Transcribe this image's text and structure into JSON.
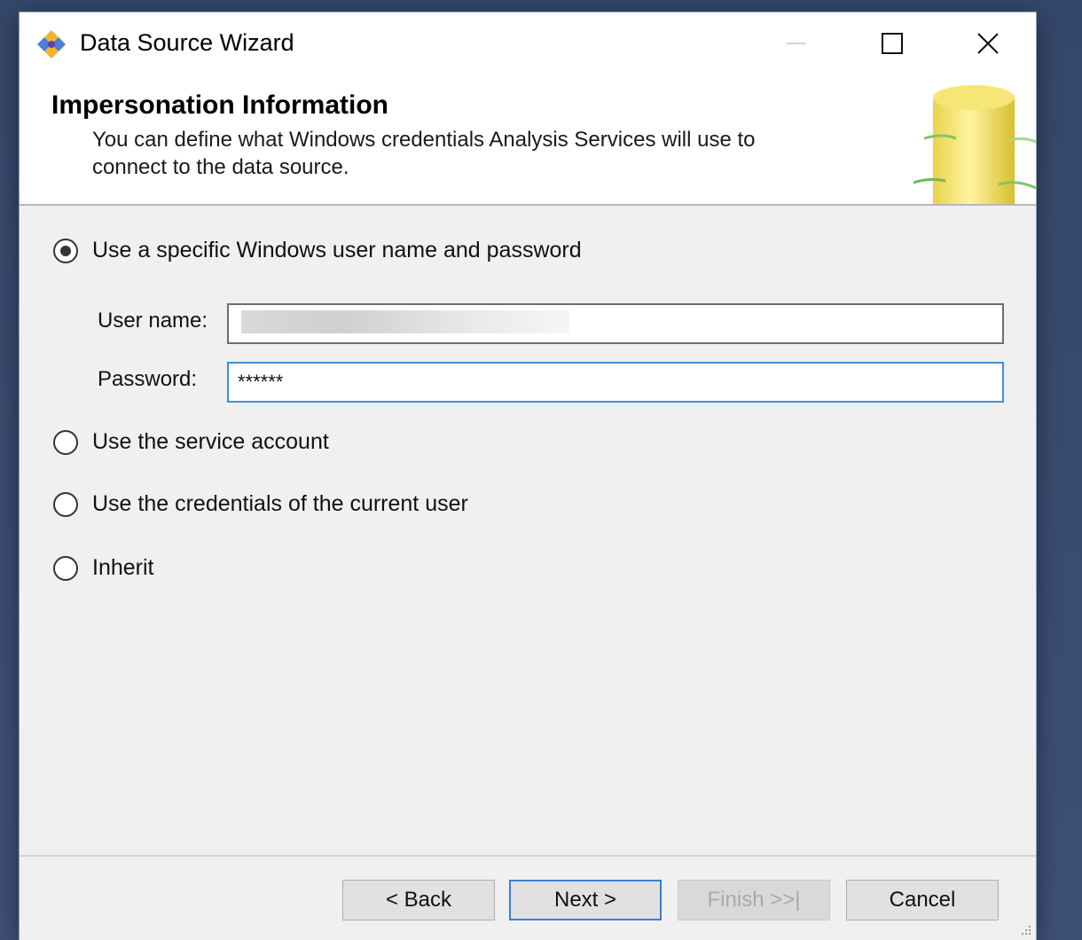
{
  "window": {
    "title": "Data Source Wizard",
    "app_icon": "wizard-diamond-icon",
    "controls": {
      "minimize_icon": "minimize-icon",
      "maximize_icon": "maximize-icon",
      "close_icon": "close-icon"
    }
  },
  "header": {
    "title": "Impersonation Information",
    "description": "You can define what Windows credentials Analysis Services will use to connect to the data source.",
    "graphic_icon": "database-cylinder-icon"
  },
  "options": [
    {
      "label": "Use a specific Windows user name and password",
      "checked": true
    },
    {
      "label": "Use the service account",
      "checked": false
    },
    {
      "label": "Use the credentials of the current user",
      "checked": false
    },
    {
      "label": "Inherit",
      "checked": false
    }
  ],
  "credentials": {
    "username_label": "User name:",
    "username_value": "",
    "password_label": "Password:",
    "password_value": "******"
  },
  "buttons": {
    "back": "< Back",
    "next": "Next >",
    "finish": "Finish >>|",
    "cancel": "Cancel"
  },
  "colors": {
    "accent": "#3c7fd0",
    "focus_border": "#3f8fd6",
    "desktop": "#3a4d6c",
    "dialog": "#f0f0f0"
  }
}
